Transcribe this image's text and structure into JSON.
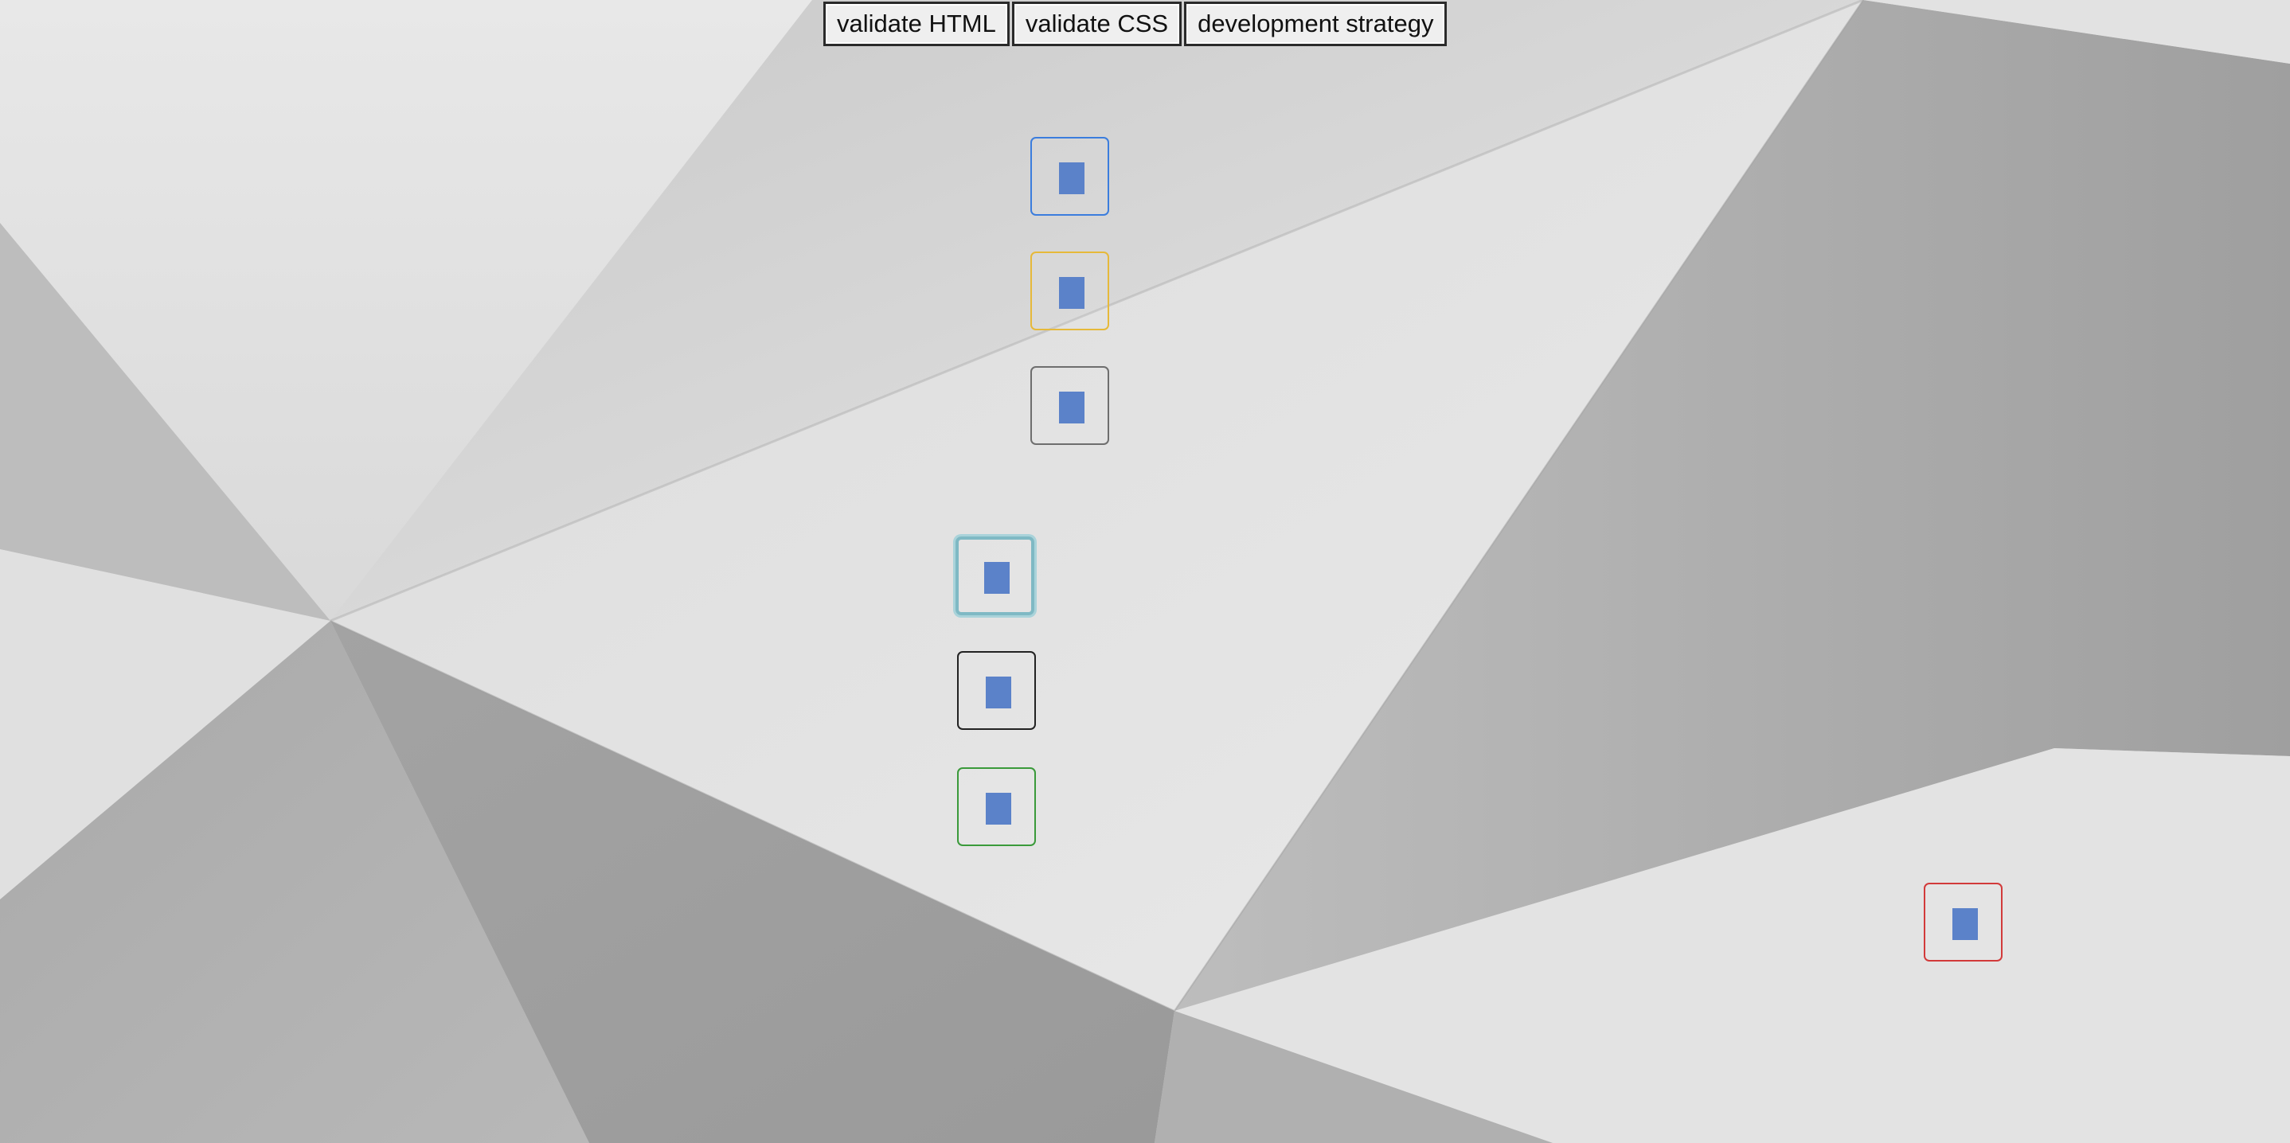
{
  "toolbar": {
    "validate_html_label": "validate HTML",
    "validate_css_label": "validate CSS",
    "development_strategy_label": "development strategy"
  },
  "tiles": [
    {
      "name": "tile-blue",
      "border_color": "#3b7ddd"
    },
    {
      "name": "tile-yellow",
      "border_color": "#e6b93a"
    },
    {
      "name": "tile-gray",
      "border_color": "#6e6e6e"
    },
    {
      "name": "tile-teal-focused",
      "border_color": "#7fb9c4"
    },
    {
      "name": "tile-black",
      "border_color": "#222222"
    },
    {
      "name": "tile-green",
      "border_color": "#3a9a3a"
    },
    {
      "name": "tile-red",
      "border_color": "#d23a3a"
    }
  ],
  "glyph_color": "#5b82c9"
}
